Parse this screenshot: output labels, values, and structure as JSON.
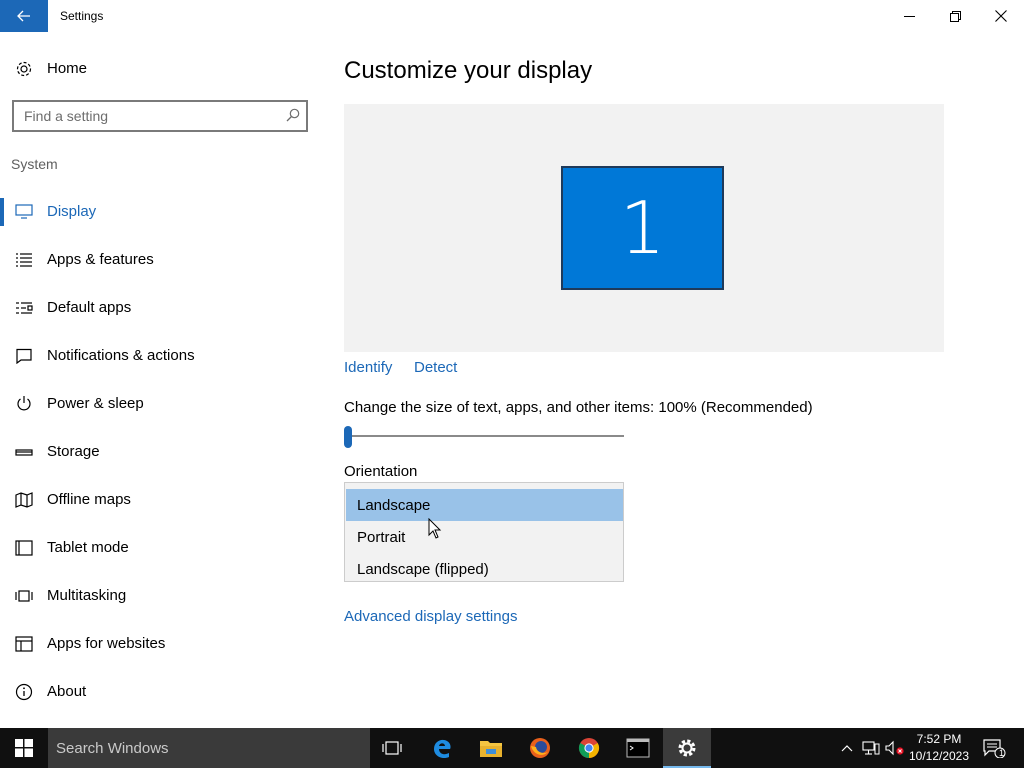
{
  "window": {
    "title": "Settings"
  },
  "sidebar": {
    "home_label": "Home",
    "search_placeholder": "Find a setting",
    "group_label": "System",
    "items": [
      {
        "label": "Display",
        "icon": "monitor-icon",
        "active": true
      },
      {
        "label": "Apps & features",
        "icon": "list-icon"
      },
      {
        "label": "Default apps",
        "icon": "default-apps-icon"
      },
      {
        "label": "Notifications & actions",
        "icon": "notification-icon"
      },
      {
        "label": "Power & sleep",
        "icon": "power-icon"
      },
      {
        "label": "Storage",
        "icon": "storage-icon"
      },
      {
        "label": "Offline maps",
        "icon": "map-icon"
      },
      {
        "label": "Tablet mode",
        "icon": "tablet-icon"
      },
      {
        "label": "Multitasking",
        "icon": "multitasking-icon"
      },
      {
        "label": "Apps for websites",
        "icon": "apps-websites-icon"
      },
      {
        "label": "About",
        "icon": "info-icon"
      }
    ]
  },
  "main": {
    "title": "Customize your display",
    "monitor_number": "1",
    "identify_label": "Identify",
    "detect_label": "Detect",
    "scale_text": "Change the size of text, apps, and other items: 100% (Recommended)",
    "scale_value_percent": 100,
    "orientation_label": "Orientation",
    "orientation_options": [
      "Landscape",
      "Portrait",
      "Landscape (flipped)"
    ],
    "orientation_selected": "Landscape",
    "advanced_link": "Advanced display settings"
  },
  "taskbar": {
    "search_text": "Search Windows",
    "time": "7:52 PM",
    "date": "10/12/2023",
    "notification_count": "1",
    "apps": [
      "task-view-icon",
      "edge-icon",
      "file-explorer-icon",
      "firefox-icon",
      "chrome-icon",
      "terminal-icon",
      "settings-icon"
    ]
  },
  "colors": {
    "accent": "#1c68b7",
    "monitor": "#0078d7",
    "selected_option": "#99c2e8",
    "taskbar": "#101010"
  }
}
